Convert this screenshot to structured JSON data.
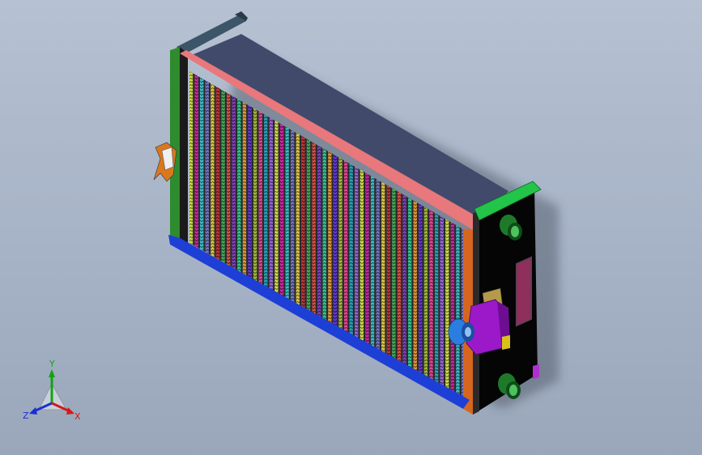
{
  "viewport": {
    "colors": {
      "background_top": "#b6c1d2",
      "background_bottom": "#9aa7ba",
      "frame_top_bar": "#e8787c",
      "frame_left_bar": "#2e8b2e",
      "frame_bottom_bar": "#1e3fd6",
      "end_plate": "#050505",
      "clamp": "#9b19c9",
      "pipe": "#1e7a2a",
      "rail": "#3c5568"
    },
    "fins": {
      "count": 52,
      "palette": [
        "#c9d93a",
        "#c61a9d",
        "#2eb8c6",
        "#6a6cbd",
        "#d8c23d",
        "#b52a2f",
        "#3aa14a",
        "#d1473a",
        "#7a33b5",
        "#25c18a",
        "#e0902e",
        "#5a2bd1",
        "#9bb431",
        "#e13a8e",
        "#1d9bb6",
        "#8f5bd4"
      ]
    }
  },
  "triad": {
    "x_label": "X",
    "y_label": "Y",
    "z_label": "Z",
    "x_color": "#d11a1a",
    "y_color": "#13a313",
    "z_color": "#1a2fd1"
  }
}
